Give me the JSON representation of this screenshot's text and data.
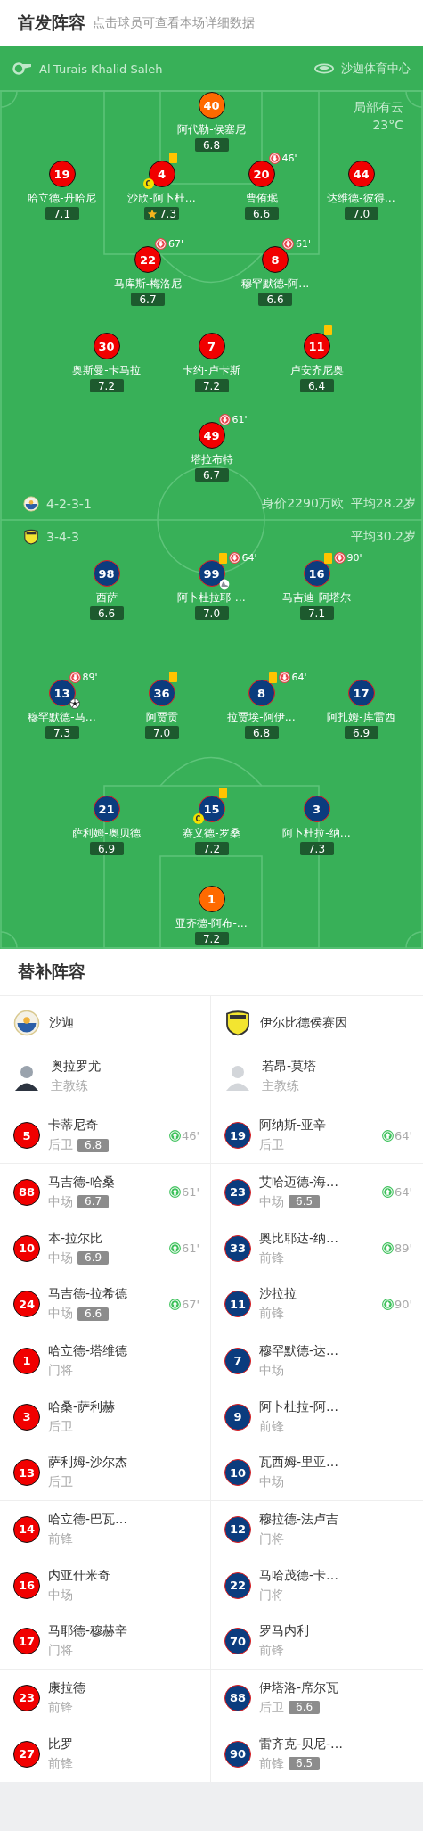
{
  "header": {
    "title": "首发阵容",
    "subtitle": "点击球员可查看本场详细数据"
  },
  "pitch": {
    "referee": "Al-Turais Khalid Saleh",
    "stadium": "沙迦体育中心",
    "weather": {
      "condition": "局部有云",
      "temperature": "23°C"
    },
    "teams": [
      {
        "kind": "home",
        "formation": "4-2-3-1",
        "summary": [
          "身价2290万欧",
          "平均28.2岁"
        ],
        "lines": [
          {
            "players": [
              {
                "number": "40",
                "name": "阿代勒-侯塞尼",
                "rating": "6.8",
                "goalkeeper": true,
                "yellow_card": false,
                "best": false,
                "goal": false,
                "assist": false
              }
            ]
          },
          {
            "players": [
              {
                "number": "19",
                "name": "哈立德-丹哈尼",
                "rating": "7.1",
                "goalkeeper": false,
                "yellow_card": false,
                "best": false,
                "goal": false,
                "assist": false
              },
              {
                "number": "4",
                "name": "沙欣-阿卜杜…",
                "rating": "7.3",
                "goalkeeper": false,
                "yellow_card": true,
                "best": true,
                "goal": false,
                "assist": false,
                "captain_badge": "C"
              },
              {
                "number": "20",
                "name": "曹侑珉",
                "rating": "6.6",
                "goalkeeper": false,
                "yellow_card": false,
                "best": false,
                "goal": false,
                "assist": false,
                "sub_off": "46'"
              },
              {
                "number": "44",
                "name": "达维德-彼得…",
                "rating": "7.0",
                "goalkeeper": false,
                "yellow_card": false,
                "best": false,
                "goal": false,
                "assist": false
              }
            ]
          },
          {
            "players": [
              {
                "number": "22",
                "name": "马库斯-梅洛尼",
                "rating": "6.7",
                "goalkeeper": false,
                "yellow_card": false,
                "best": false,
                "goal": false,
                "assist": false,
                "sub_off": "67'"
              },
              {
                "number": "8",
                "name": "穆罕默德-阿…",
                "rating": "6.6",
                "goalkeeper": false,
                "yellow_card": false,
                "best": false,
                "goal": false,
                "assist": false,
                "sub_off": "61'"
              }
            ]
          },
          {
            "players": [
              {
                "number": "30",
                "name": "奥斯曼-卡马拉",
                "rating": "7.2",
                "goalkeeper": false,
                "yellow_card": false,
                "best": false,
                "goal": false,
                "assist": false
              },
              {
                "number": "7",
                "name": "卡约-卢卡斯",
                "rating": "7.2",
                "goalkeeper": false,
                "yellow_card": false,
                "best": false,
                "goal": false,
                "assist": false
              },
              {
                "number": "11",
                "name": "卢安齐尼奥",
                "rating": "6.4",
                "goalkeeper": false,
                "yellow_card": true,
                "best": false,
                "goal": false,
                "assist": false
              }
            ]
          },
          {
            "players": [
              {
                "number": "49",
                "name": "塔拉布特",
                "rating": "6.7",
                "goalkeeper": false,
                "yellow_card": false,
                "best": false,
                "goal": false,
                "assist": false,
                "sub_off": "61'"
              }
            ]
          }
        ]
      },
      {
        "kind": "away",
        "formation": "3-4-3",
        "summary": [
          "平均30.2岁"
        ],
        "lines": [
          {
            "players": [
              {
                "number": "98",
                "name": "西萨",
                "rating": "6.6",
                "goalkeeper": false,
                "yellow_card": false,
                "best": false,
                "goal": false,
                "assist": false
              },
              {
                "number": "99",
                "name": "阿卜杜拉耶-…",
                "rating": "7.0",
                "goalkeeper": false,
                "yellow_card": true,
                "best": false,
                "goal": false,
                "assist": true,
                "sub_off": "64'"
              },
              {
                "number": "16",
                "name": "马吉迪-阿塔尔",
                "rating": "7.1",
                "goalkeeper": false,
                "yellow_card": true,
                "best": false,
                "goal": false,
                "assist": false,
                "sub_off": "90'"
              }
            ]
          },
          {
            "players": [
              {
                "number": "13",
                "name": "穆罕默德-马…",
                "rating": "7.3",
                "goalkeeper": false,
                "yellow_card": false,
                "best": false,
                "goal": true,
                "assist": false,
                "sub_off": "89'"
              },
              {
                "number": "36",
                "name": "阿贾贡",
                "rating": "7.0",
                "goalkeeper": false,
                "yellow_card": true,
                "best": false,
                "goal": false,
                "assist": false
              },
              {
                "number": "8",
                "name": "拉贾埃-阿伊…",
                "rating": "6.8",
                "goalkeeper": false,
                "yellow_card": true,
                "best": false,
                "goal": false,
                "assist": false,
                "sub_off": "64'"
              },
              {
                "number": "17",
                "name": "阿扎姆-库雷西",
                "rating": "6.9",
                "goalkeeper": false,
                "yellow_card": false,
                "best": false,
                "goal": false,
                "assist": false
              }
            ]
          },
          {
            "players": [
              {
                "number": "21",
                "name": "萨利姆-奥贝德",
                "rating": "6.9",
                "goalkeeper": false,
                "yellow_card": false,
                "best": false,
                "goal": false,
                "assist": false
              },
              {
                "number": "15",
                "name": "赛义德-罗桑",
                "rating": "7.2",
                "goalkeeper": false,
                "yellow_card": true,
                "best": false,
                "goal": false,
                "assist": false,
                "captain_badge": "C"
              },
              {
                "number": "3",
                "name": "阿卜杜拉-纳…",
                "rating": "7.3",
                "goalkeeper": false,
                "yellow_card": false,
                "best": false,
                "goal": false,
                "assist": false
              }
            ]
          },
          {
            "players": [
              {
                "number": "1",
                "name": "亚齐德-阿布-…",
                "rating": "7.2",
                "goalkeeper": true,
                "yellow_card": false,
                "best": false,
                "goal": false,
                "assist": false
              }
            ]
          }
        ]
      }
    ]
  },
  "substitutes": {
    "title": "替补阵容",
    "teams": [
      {
        "kind": "home",
        "name": "沙迦",
        "coach": {
          "name": "奥拉罗尤",
          "role": "主教练"
        },
        "players": [
          {
            "number": "5",
            "name": "卡蒂尼奇",
            "position": "后卫",
            "rating": "6.8",
            "sub_on": "46'"
          },
          {
            "number": "88",
            "name": "马吉德-哈桑",
            "position": "中场",
            "rating": "6.7",
            "sub_on": "61'"
          },
          {
            "number": "10",
            "name": "本-拉尔比",
            "position": "中场",
            "rating": "6.9",
            "sub_on": "61'"
          },
          {
            "number": "24",
            "name": "马吉德-拉希德",
            "position": "中场",
            "rating": "6.6",
            "sub_on": "67'"
          },
          {
            "number": "1",
            "name": "哈立德-塔维德",
            "position": "门将"
          },
          {
            "number": "3",
            "name": "哈桑-萨利赫",
            "position": "后卫"
          },
          {
            "number": "13",
            "name": "萨利姆-沙尔杰",
            "position": "后卫"
          },
          {
            "number": "14",
            "name": "哈立德-巴瓦…",
            "position": "前锋"
          },
          {
            "number": "16",
            "name": "内亚什米奇",
            "position": "中场"
          },
          {
            "number": "17",
            "name": "马耶德-穆赫辛",
            "position": "门将"
          },
          {
            "number": "23",
            "name": "康拉德",
            "position": "前锋"
          },
          {
            "number": "27",
            "name": "比罗",
            "position": "前锋"
          }
        ]
      },
      {
        "kind": "away",
        "name": "伊尔比德侯赛因",
        "coach": {
          "name": "若昂-莫塔",
          "role": "主教练"
        },
        "players": [
          {
            "number": "19",
            "name": "阿纳斯-亚辛",
            "position": "后卫",
            "sub_on": "64'"
          },
          {
            "number": "23",
            "name": "艾哈迈德-海…",
            "position": "中场",
            "rating": "6.5",
            "sub_on": "64'"
          },
          {
            "number": "33",
            "name": "奥比耶达-纳…",
            "position": "前锋",
            "sub_on": "89'"
          },
          {
            "number": "11",
            "name": "沙拉拉",
            "position": "前锋",
            "sub_on": "90'"
          },
          {
            "number": "7",
            "name": "穆罕默德-达…",
            "position": "中场"
          },
          {
            "number": "9",
            "name": "阿卜杜拉-阿…",
            "position": "前锋"
          },
          {
            "number": "10",
            "name": "瓦西姆-里亚…",
            "position": "中场"
          },
          {
            "number": "12",
            "name": "穆拉德-法卢吉",
            "position": "门将"
          },
          {
            "number": "22",
            "name": "马哈茂德-卡…",
            "position": "门将"
          },
          {
            "number": "70",
            "name": "罗马内利",
            "position": "前锋"
          },
          {
            "number": "88",
            "name": "伊塔洛-席尔瓦",
            "position": "后卫",
            "rating": "6.6"
          },
          {
            "number": "90",
            "name": "雷齐克-贝尼-…",
            "position": "前锋",
            "rating": "6.5"
          }
        ]
      }
    ]
  }
}
